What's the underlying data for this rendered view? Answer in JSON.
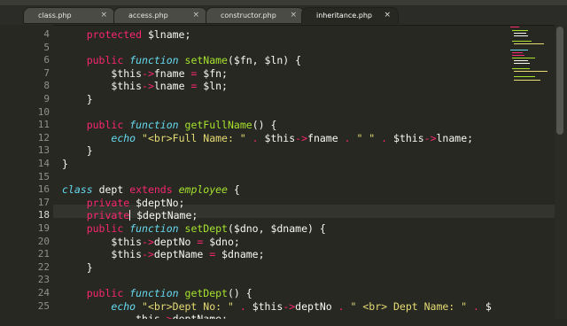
{
  "tabs": [
    {
      "label": "class.php",
      "active": false
    },
    {
      "label": "access.php",
      "active": false
    },
    {
      "label": "constructor.php",
      "active": false
    },
    {
      "label": "inheritance.php",
      "active": true
    }
  ],
  "close_glyph": "×",
  "current_line": 18,
  "lines": [
    {
      "n": "4",
      "t": [
        [
          "kw",
          "protected"
        ],
        [
          "var",
          " $lname;"
        ]
      ]
    },
    {
      "n": "5",
      "t": []
    },
    {
      "n": "6",
      "t": [
        [
          "kw",
          "public"
        ],
        [
          "var",
          " "
        ],
        [
          "sto",
          "function"
        ],
        [
          "var",
          " "
        ],
        [
          "fn",
          "setName"
        ],
        [
          "var",
          "($fn, $ln) {"
        ]
      ]
    },
    {
      "n": "7",
      "t": [
        [
          "var",
          "$this"
        ],
        [
          "kw",
          "->"
        ],
        [
          "var",
          "fname "
        ],
        [
          "kw",
          "="
        ],
        [
          "var",
          " $fn;"
        ]
      ]
    },
    {
      "n": "8",
      "t": [
        [
          "var",
          "$this"
        ],
        [
          "kw",
          "->"
        ],
        [
          "var",
          "lname "
        ],
        [
          "kw",
          "="
        ],
        [
          "var",
          " $ln;"
        ]
      ]
    },
    {
      "n": "9",
      "t": [
        [
          "var",
          "}"
        ]
      ]
    },
    {
      "n": "10",
      "t": []
    },
    {
      "n": "11",
      "t": [
        [
          "kw",
          "public"
        ],
        [
          "var",
          " "
        ],
        [
          "sto",
          "function"
        ],
        [
          "var",
          " "
        ],
        [
          "fn",
          "getFullName"
        ],
        [
          "var",
          "() {"
        ]
      ]
    },
    {
      "n": "12",
      "t": [
        [
          "sto",
          "echo"
        ],
        [
          "var",
          " "
        ],
        [
          "str",
          "\"<br>Full Name: \""
        ],
        [
          "var",
          " "
        ],
        [
          "kw",
          "."
        ],
        [
          "var",
          " $this"
        ],
        [
          "kw",
          "->"
        ],
        [
          "var",
          "fname "
        ],
        [
          "kw",
          "."
        ],
        [
          "var",
          " "
        ],
        [
          "str",
          "\" \""
        ],
        [
          "var",
          " "
        ],
        [
          "kw",
          "."
        ],
        [
          "var",
          " $this"
        ],
        [
          "kw",
          "->"
        ],
        [
          "var",
          "lname;"
        ]
      ]
    },
    {
      "n": "13",
      "t": [
        [
          "var",
          "}"
        ]
      ]
    },
    {
      "n": "14",
      "t": [
        [
          "var",
          "}"
        ]
      ]
    },
    {
      "n": "15",
      "t": []
    },
    {
      "n": "16",
      "t": [
        [
          "sto",
          "class"
        ],
        [
          "var",
          " "
        ],
        [
          "var",
          "dept "
        ],
        [
          "kw",
          "extends"
        ],
        [
          "var",
          " "
        ],
        [
          "cls",
          "employee"
        ],
        [
          "var",
          " {"
        ]
      ]
    },
    {
      "n": "17",
      "t": [
        [
          "kw",
          "private"
        ],
        [
          "var",
          " $deptNo;"
        ]
      ]
    },
    {
      "n": "18",
      "t": [
        [
          "kw",
          "private"
        ],
        [
          "caret",
          ""
        ],
        [
          "var",
          " $deptName;"
        ]
      ]
    },
    {
      "n": "19",
      "t": [
        [
          "kw",
          "public"
        ],
        [
          "var",
          " "
        ],
        [
          "sto",
          "function"
        ],
        [
          "var",
          " "
        ],
        [
          "fn",
          "setDept"
        ],
        [
          "var",
          "($dno, $dname) {"
        ]
      ]
    },
    {
      "n": "20",
      "t": [
        [
          "var",
          "$this"
        ],
        [
          "kw",
          "->"
        ],
        [
          "var",
          "deptNo "
        ],
        [
          "kw",
          "="
        ],
        [
          "var",
          " $dno;"
        ]
      ]
    },
    {
      "n": "21",
      "t": [
        [
          "var",
          "$this"
        ],
        [
          "kw",
          "->"
        ],
        [
          "var",
          "deptName "
        ],
        [
          "kw",
          "="
        ],
        [
          "var",
          " $dname;"
        ]
      ]
    },
    {
      "n": "22",
      "t": [
        [
          "var",
          "}"
        ]
      ]
    },
    {
      "n": "23",
      "t": []
    },
    {
      "n": "24",
      "t": [
        [
          "kw",
          "public"
        ],
        [
          "var",
          " "
        ],
        [
          "sto",
          "function"
        ],
        [
          "var",
          " "
        ],
        [
          "fn",
          "getDept"
        ],
        [
          "var",
          "() {"
        ]
      ]
    },
    {
      "n": "25",
      "t": [
        [
          "sto",
          "echo"
        ],
        [
          "var",
          " "
        ],
        [
          "str",
          "\"<br>Dept No: \""
        ],
        [
          "var",
          " "
        ],
        [
          "kw",
          "."
        ],
        [
          "var",
          " $this"
        ],
        [
          "kw",
          "->"
        ],
        [
          "var",
          "deptNo "
        ],
        [
          "kw",
          "."
        ],
        [
          "var",
          " "
        ],
        [
          "str",
          "\" <br> Dept Name: \""
        ],
        [
          "var",
          " "
        ],
        [
          "kw",
          "."
        ],
        [
          "var",
          " $"
        ]
      ]
    },
    {
      "n": "",
      "t": [
        [
          "var",
          "this"
        ],
        [
          "kw",
          "->"
        ],
        [
          "var",
          "deptName;"
        ]
      ]
    }
  ]
}
